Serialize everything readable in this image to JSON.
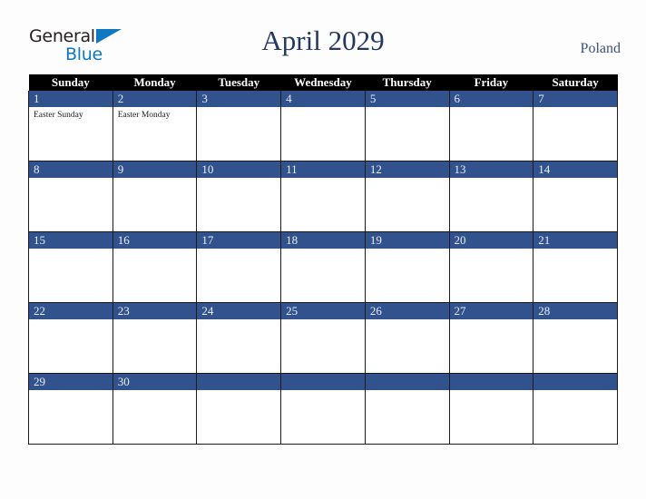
{
  "brand": {
    "name_part1": "General",
    "name_part2": "Blue",
    "accent_color": "#1077c3",
    "triangle_icon": "triangle-icon"
  },
  "header": {
    "title": "April 2029",
    "country": "Poland",
    "title_color": "#24385f"
  },
  "calendar": {
    "weekday_headers": [
      "Sunday",
      "Monday",
      "Tuesday",
      "Wednesday",
      "Thursday",
      "Friday",
      "Saturday"
    ],
    "header_bg": "#000000",
    "daybar_bg": "#31528d",
    "weeks": [
      [
        {
          "day": "1",
          "events": [
            "Easter Sunday"
          ]
        },
        {
          "day": "2",
          "events": [
            "Easter Monday"
          ]
        },
        {
          "day": "3",
          "events": []
        },
        {
          "day": "4",
          "events": []
        },
        {
          "day": "5",
          "events": []
        },
        {
          "day": "6",
          "events": []
        },
        {
          "day": "7",
          "events": []
        }
      ],
      [
        {
          "day": "8",
          "events": []
        },
        {
          "day": "9",
          "events": []
        },
        {
          "day": "10",
          "events": []
        },
        {
          "day": "11",
          "events": []
        },
        {
          "day": "12",
          "events": []
        },
        {
          "day": "13",
          "events": []
        },
        {
          "day": "14",
          "events": []
        }
      ],
      [
        {
          "day": "15",
          "events": []
        },
        {
          "day": "16",
          "events": []
        },
        {
          "day": "17",
          "events": []
        },
        {
          "day": "18",
          "events": []
        },
        {
          "day": "19",
          "events": []
        },
        {
          "day": "20",
          "events": []
        },
        {
          "day": "21",
          "events": []
        }
      ],
      [
        {
          "day": "22",
          "events": []
        },
        {
          "day": "23",
          "events": []
        },
        {
          "day": "24",
          "events": []
        },
        {
          "day": "25",
          "events": []
        },
        {
          "day": "26",
          "events": []
        },
        {
          "day": "27",
          "events": []
        },
        {
          "day": "28",
          "events": []
        }
      ],
      [
        {
          "day": "29",
          "events": []
        },
        {
          "day": "30",
          "events": []
        },
        {
          "day": "",
          "events": []
        },
        {
          "day": "",
          "events": []
        },
        {
          "day": "",
          "events": []
        },
        {
          "day": "",
          "events": []
        },
        {
          "day": "",
          "events": []
        }
      ]
    ]
  }
}
